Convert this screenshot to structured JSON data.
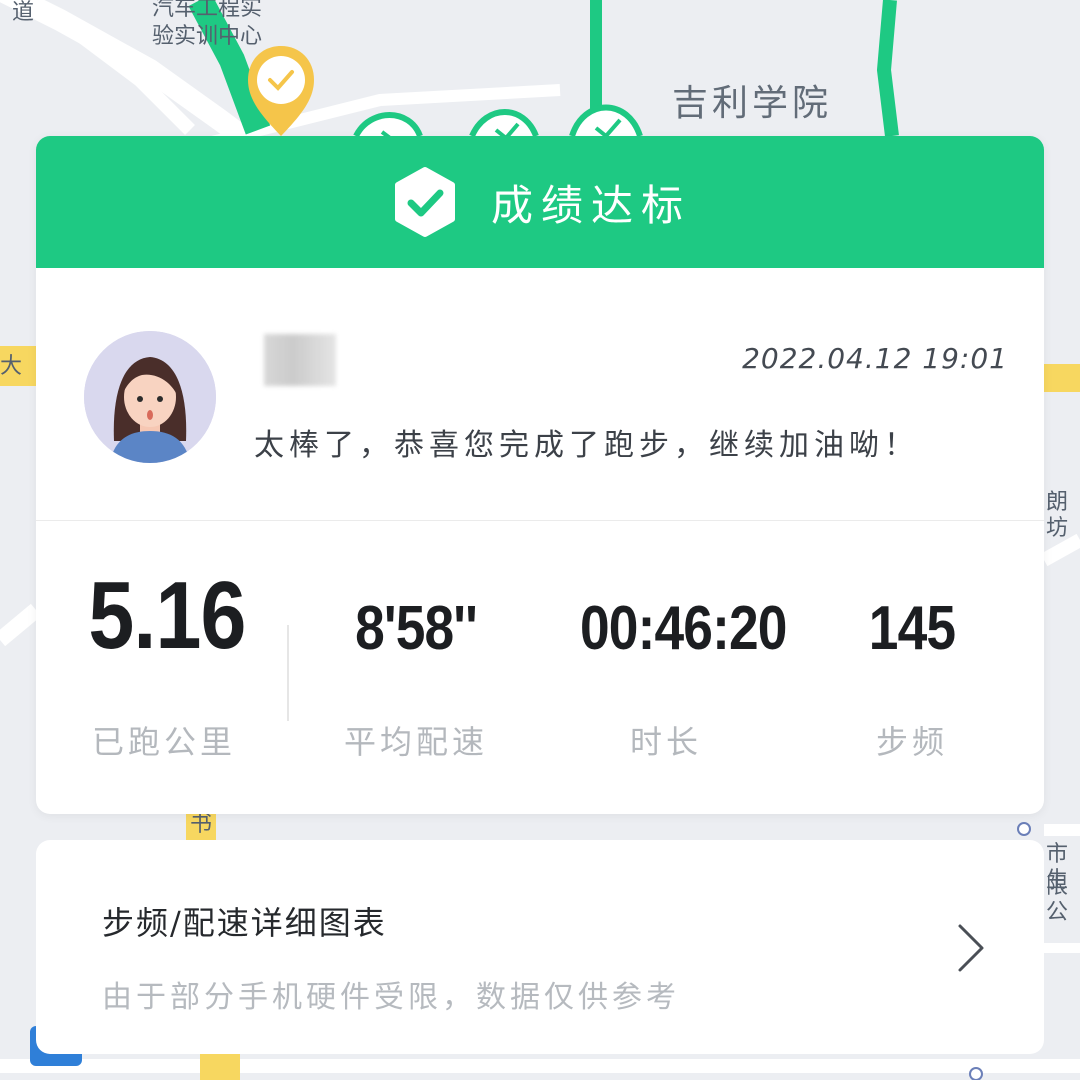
{
  "map": {
    "labels": {
      "road_fragment": "道",
      "facility_line1": "汽车工程实",
      "facility_line2": "验实训中心",
      "college": "吉利学院",
      "left_edge": "大",
      "right_edge": "朗坊",
      "bottom_road": "书",
      "bottom_right_line1": "市生",
      "bottom_right_line2": "限公"
    },
    "route_color": "#1ec983",
    "start_marker_color": "#f5c54a",
    "start_marker_icon": "check-icon",
    "checkpoint_icon": "check-icon"
  },
  "result": {
    "header_title": "成绩达标",
    "header_icon": "shield-check-icon",
    "header_color": "#1ec983",
    "user": {
      "avatar_icon": "avatar-girl-icon",
      "datetime": "2022.04.12 19:01",
      "message": "太棒了，恭喜您完成了跑步，继续加油呦！"
    },
    "stats": {
      "distance": {
        "value": "5.16",
        "label": "已跑公里"
      },
      "pace": {
        "value": "8'58''",
        "label": "平均配速"
      },
      "duration": {
        "value": "00:46:20",
        "label": "时长"
      },
      "cadence": {
        "value": "145",
        "label": "步频"
      }
    }
  },
  "chart_link": {
    "title": "步频/配速详细图表",
    "note": "由于部分手机硬件受限，数据仅供参考",
    "icon": "chevron-right-icon"
  }
}
